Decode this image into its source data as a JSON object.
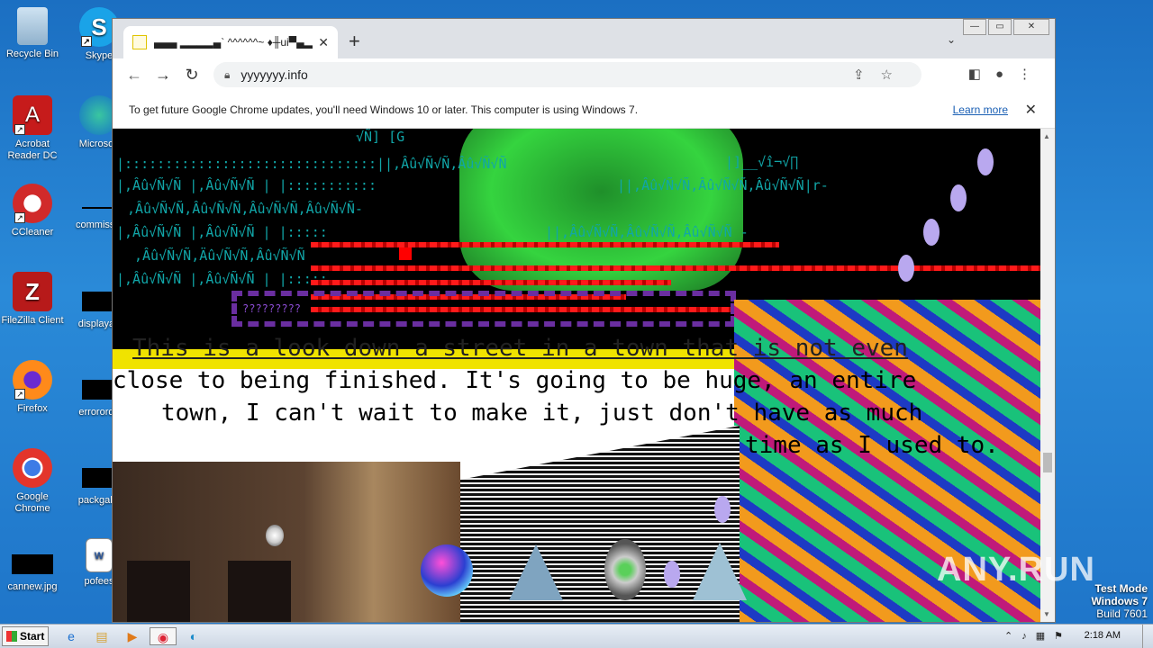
{
  "desktop": {
    "icons": [
      {
        "label": "Recycle Bin",
        "icon": "recycle-bin-icon"
      },
      {
        "label": "Skype",
        "icon": "skype-icon"
      },
      {
        "label": "Acrobat Reader DC",
        "icon": "acrobat-icon"
      },
      {
        "label": "Microsoft",
        "icon": "edge-icon"
      },
      {
        "label": "CCleaner",
        "icon": "ccleaner-icon"
      },
      {
        "label": "commissio",
        "icon": "file-icon"
      },
      {
        "label": "FileZilla Client",
        "icon": "filezilla-icon"
      },
      {
        "label": "displayau",
        "icon": "file-icon"
      },
      {
        "label": "Firefox",
        "icon": "firefox-icon"
      },
      {
        "label": "errororde",
        "icon": "file-icon"
      },
      {
        "label": "Google Chrome",
        "icon": "chrome-icon"
      },
      {
        "label": "packgalle",
        "icon": "file-icon"
      },
      {
        "label": "cannew.jpg",
        "icon": "image-icon"
      },
      {
        "label": "pofees",
        "icon": "word-doc-icon"
      }
    ]
  },
  "browser": {
    "tab_title": "▄▄▄ ▂▂▂▂▄` ^^^^^^~ ♦╫ui▀▄▂",
    "tab_close": "✕",
    "new_tab": "+",
    "tab_search": "⌄",
    "window_controls": {
      "minimize": "—",
      "restore": "▭",
      "close": "✕"
    },
    "url": "yyyyyyy.info",
    "infobar_text": "To get future Google Chrome updates, you'll need Windows 10 or later. This computer is using Windows 7.",
    "infobar_link": "Learn more",
    "infobar_close": "✕"
  },
  "page": {
    "glitch_lines": [
      "√Ñ] [G",
      "|:::::::::::::::::::::::::::::::||,Âû√Ñ√Ñ,Âû√Ñ√Ñ",
      "|,Âû√Ñ√Ñ |,Âû√Ñ√Ñ | |:::::::::::",
      ",Âû√Ñ√Ñ,Âû√Ñ√Ñ,Âû√Ñ√Ñ,Âû√Ñ√Ñ-",
      "|,Âû√Ñ√Ñ |,Âû√Ñ√Ñ | |:::::",
      "  ,Âû√Ñ√Ñ,Äû√Ñ√Ñ,Âû√Ñ√Ñ",
      "|,Âû√Ñ√Ñ |,Âû√Ñ√Ñ | |:::::"
    ],
    "glitch_right": [
      "||,Âû√Ñ√Ñ,Âû√Ñ√Ñ,Âû√Ñ√Ñ|r-",
      "||,Âû√Ñ√Ñ,Âû√Ñ√Ñ,Âû√Ñ√Ñ -",
      "|]__√î¬√∏"
    ],
    "purple_text": "?????????",
    "story_lines": [
      "This is a look down a street in a town that is not even",
      "close to being finished. It's going to be huge, an entire",
      "town, I can't wait to make it, just don't have as much",
      "time as I used to."
    ]
  },
  "overlay": {
    "watermark": "ANY.RUN",
    "test_mode": [
      "Test Mode",
      "Windows 7",
      "Build 7601"
    ]
  },
  "taskbar": {
    "start_label": "Start",
    "clock": "2:18 AM"
  }
}
